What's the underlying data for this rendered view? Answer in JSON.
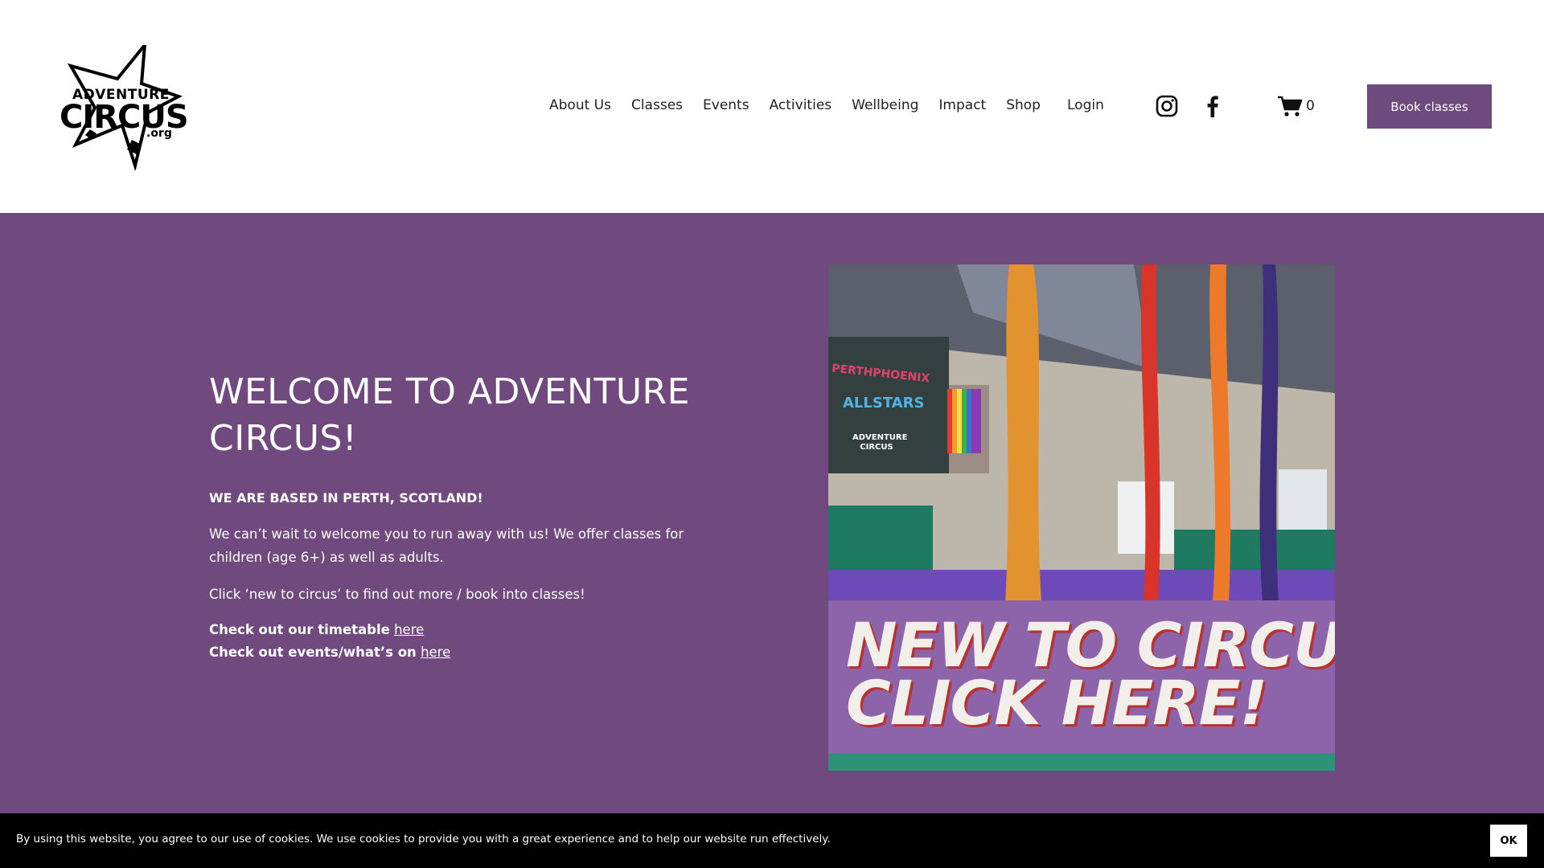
{
  "header": {
    "logo": {
      "line1": "ADVENTURE",
      "line2": "CIRCUS",
      "line3": ".org"
    },
    "nav": [
      "About Us",
      "Classes",
      "Events",
      "Activities",
      "Wellbeing",
      "Impact",
      "Shop"
    ],
    "login": "Login",
    "social": [
      "instagram-icon",
      "facebook-icon"
    ],
    "cart_count": "0",
    "book_button": "Book classes"
  },
  "hero": {
    "title": "WELCOME TO  ADVENTURE CIRCUS!",
    "subtitle": "WE ARE BASED IN PERTH, SCOTLAND!",
    "para1": "We can’t wait to welcome you to run away with us!  We offer classes for children (age 6+) as well as adults.",
    "para2": "Click ‘new to circus’ to find out more / book into classes!",
    "timetable_prefix": "Check out our timetable",
    "timetable_link": "here",
    "events_prefix": "Check out events/what’s on",
    "events_link": "here",
    "promo": {
      "line1": "NEW TO CIRCUS?",
      "line2": "CLICK HERE!",
      "banner_allstars": "ALLSTARS",
      "banner_perth": "PERTHPHOENIX",
      "banner_logo": "ADVENTURE CIRCUS"
    }
  },
  "cookie": {
    "text": "By using this website, you agree to our use of cookies. We use cookies to provide you with a great experience and to help our website run effectively.",
    "ok": "OK"
  },
  "colors": {
    "accent": "#704a7e",
    "button": "#6f4a7e",
    "cookie_bg": "#000000"
  }
}
